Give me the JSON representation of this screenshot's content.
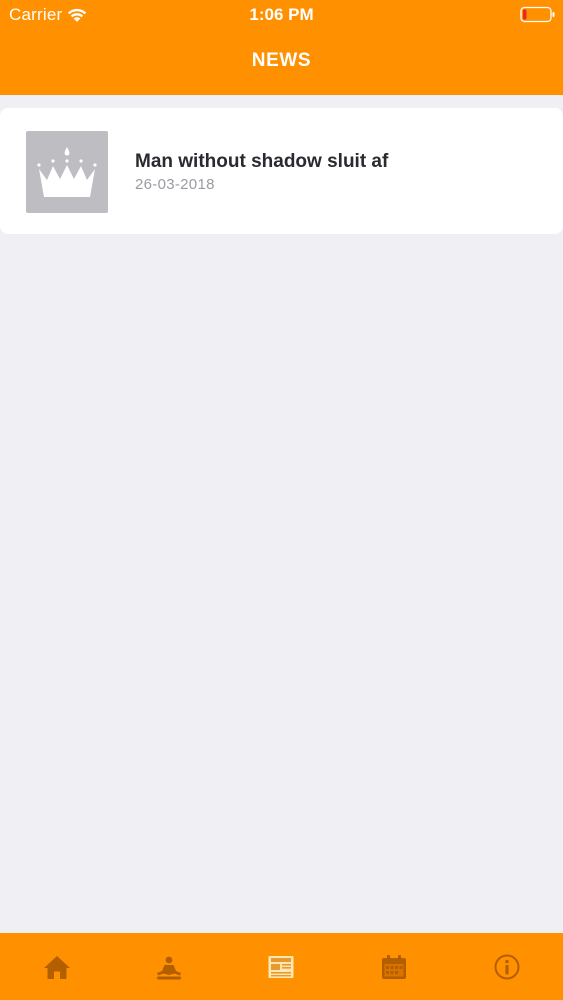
{
  "status_bar": {
    "carrier": "Carrier",
    "time": "1:06 PM",
    "wifi_icon": "wifi-icon",
    "battery_icon": "battery-low-icon"
  },
  "header": {
    "title": "NEWS"
  },
  "news": [
    {
      "title": "Man without shadow sluit af",
      "date": "26-03-2018",
      "thumbnail_icon": "crown-icon"
    }
  ],
  "tab_bar": {
    "tabs": [
      {
        "icon": "home-icon",
        "active": false
      },
      {
        "icon": "meditation-icon",
        "active": false
      },
      {
        "icon": "newspaper-icon",
        "active": true
      },
      {
        "icon": "calendar-icon",
        "active": false
      },
      {
        "icon": "info-icon",
        "active": false
      }
    ],
    "active_color": "#FFE7B3",
    "inactive_color": "#B35F00"
  },
  "colors": {
    "brand": "#FF9000",
    "background": "#EFEFF4",
    "battery_low": "#E8272B"
  }
}
